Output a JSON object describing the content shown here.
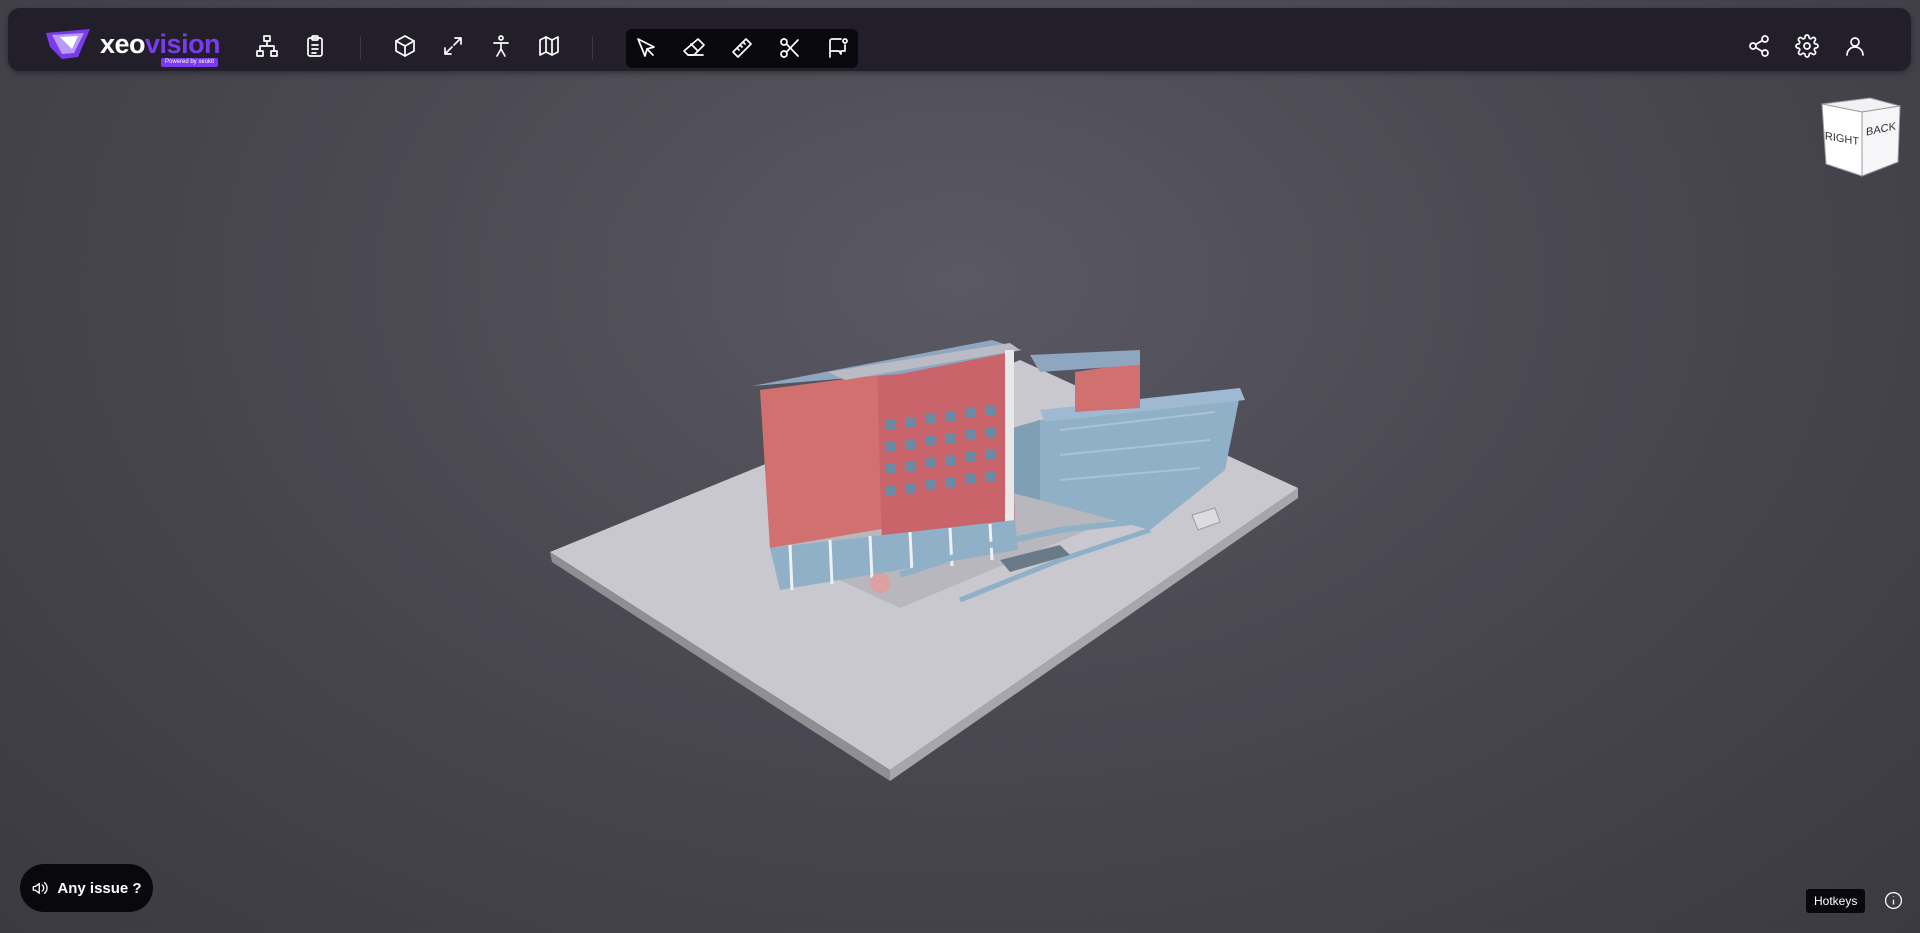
{
  "app": {
    "logo_primary": "xeo",
    "logo_accent": "vision",
    "logo_tagline": "Powered by xeokit",
    "brand_color": "#7c3aed",
    "toolbar_bg": "#221f2b"
  },
  "toolbar": {
    "left_buttons": [
      {
        "icon": "tree-hierarchy-icon"
      },
      {
        "icon": "clipboard-list-icon"
      }
    ],
    "view_buttons": [
      {
        "icon": "cube-icon"
      },
      {
        "icon": "expand-arrows-icon"
      },
      {
        "icon": "person-walk-icon"
      },
      {
        "icon": "map-icon"
      }
    ],
    "tool_buttons": [
      {
        "icon": "select-cursor-icon"
      },
      {
        "icon": "eraser-icon"
      },
      {
        "icon": "ruler-measure-icon"
      },
      {
        "icon": "scissors-section-icon"
      },
      {
        "icon": "annotation-flag-icon"
      }
    ],
    "right_buttons": [
      {
        "icon": "share-icon"
      },
      {
        "icon": "gear-icon"
      },
      {
        "icon": "user-icon"
      }
    ]
  },
  "navcube": {
    "face_right": "RIGHT",
    "face_back": "BACK"
  },
  "footer": {
    "issue_label": "Any issue ?",
    "hotkeys_label": "Hotkeys",
    "info_icon": "info-icon"
  },
  "scene": {
    "background": "#4a4851",
    "ground_color": "#c9c8ce",
    "facade_color": "#d0706f",
    "glass_color": "#8fb0c6"
  }
}
